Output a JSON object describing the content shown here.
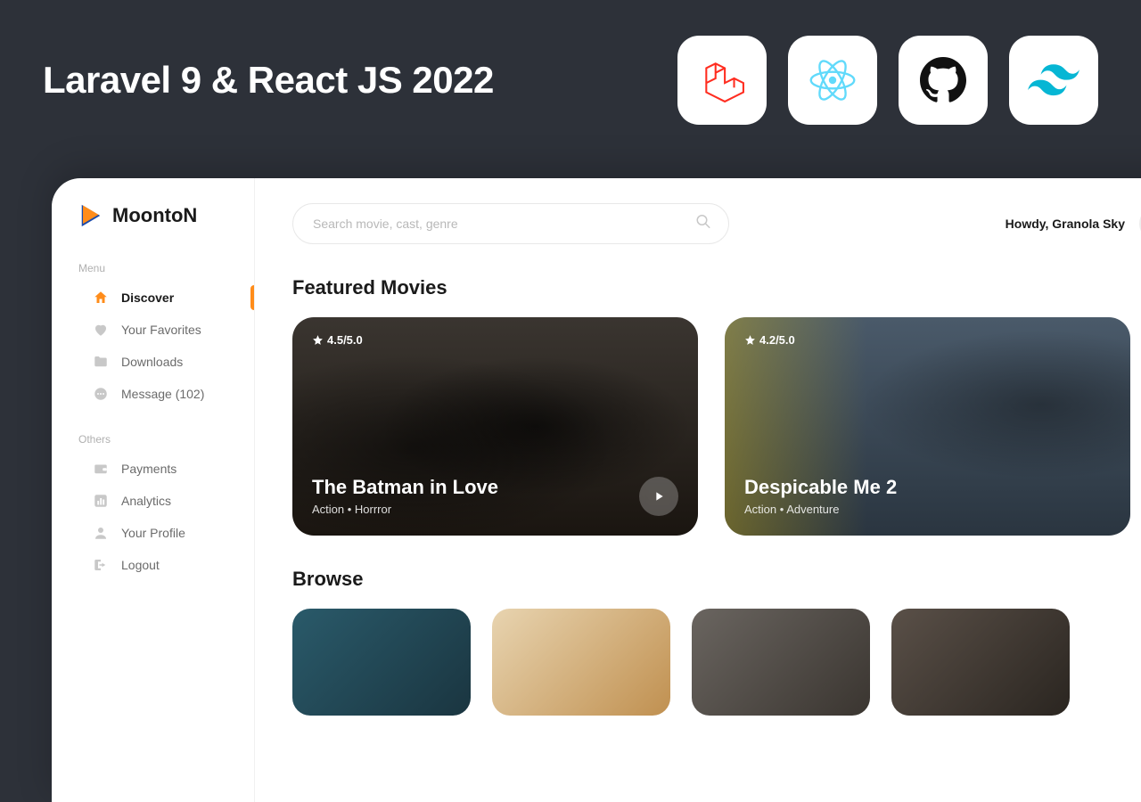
{
  "banner": {
    "title": "Laravel 9 & React JS 2022",
    "icons": [
      "laravel-icon",
      "react-icon",
      "github-icon",
      "tailwind-icon"
    ]
  },
  "brand": {
    "name": "MoontoN"
  },
  "search": {
    "placeholder": "Search movie, cast, genre"
  },
  "user": {
    "greeting": "Howdy, Granola Sky"
  },
  "sidebar": {
    "sections": [
      {
        "label": "Menu",
        "items": [
          {
            "label": "Discover",
            "icon": "home-icon",
            "active": true
          },
          {
            "label": "Your Favorites",
            "icon": "heart-icon",
            "active": false
          },
          {
            "label": "Downloads",
            "icon": "folder-icon",
            "active": false
          },
          {
            "label": "Message (102)",
            "icon": "message-icon",
            "active": false
          }
        ]
      },
      {
        "label": "Others",
        "items": [
          {
            "label": "Payments",
            "icon": "wallet-icon",
            "active": false
          },
          {
            "label": "Analytics",
            "icon": "chart-icon",
            "active": false
          },
          {
            "label": "Your Profile",
            "icon": "user-icon",
            "active": false
          },
          {
            "label": "Logout",
            "icon": "logout-icon",
            "active": false
          }
        ]
      }
    ]
  },
  "sections": {
    "featured_title": "Featured Movies",
    "browse_title": "Browse"
  },
  "featured": [
    {
      "rating": "4.5/5.0",
      "title": "The Batman in Love",
      "genre": "Action • Horrror"
    },
    {
      "rating": "4.2/5.0",
      "title": "Despicable Me 2",
      "genre": "Action • Adventure"
    }
  ]
}
